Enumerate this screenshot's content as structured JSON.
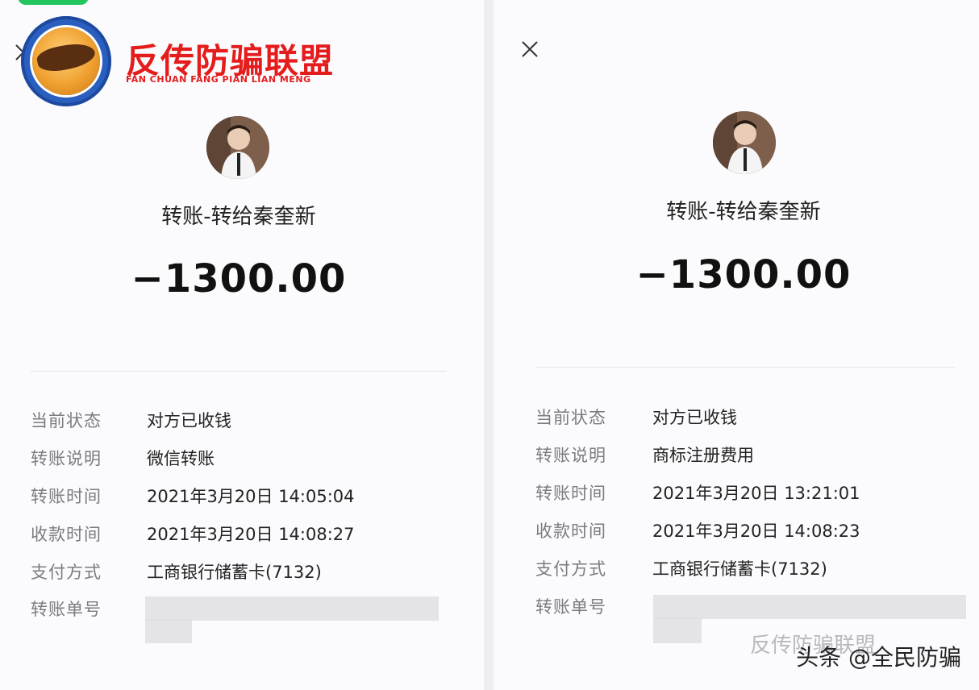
{
  "logo": {
    "cn": "反传防骗联盟",
    "pinyin": "FAN CHUAN FANG PIAN LIAN MENG"
  },
  "watermark": {
    "main": "头条 @全民防骗",
    "ghost": "反传防骗联盟"
  },
  "labels": {
    "status": "当前状态",
    "note": "转账说明",
    "transfer_time": "转账时间",
    "receive_time": "收款时间",
    "payment_method": "支付方式",
    "order_no": "转账单号"
  },
  "left": {
    "title": "转账-转给秦奎新",
    "amount": "−1300.00",
    "status": "对方已收钱",
    "note": "微信转账",
    "transfer_time": "2021年3月20日 14:05:04",
    "receive_time": "2021年3月20日 14:08:27",
    "payment_method": "工商银行储蓄卡(7132)"
  },
  "right": {
    "title": "转账-转给秦奎新",
    "amount": "−1300.00",
    "status": "对方已收钱",
    "note": "商标注册费用",
    "transfer_time": "2021年3月20日 13:21:01",
    "receive_time": "2021年3月20日 14:08:23",
    "payment_method": "工商银行储蓄卡(7132)"
  },
  "colors": {
    "status_pill": "#22c55e",
    "logo_red": "#e51c1c",
    "logo_blue": "#2a5fc0"
  },
  "icons": [
    "close-icon",
    "avatar-photo",
    "logo-badge"
  ]
}
